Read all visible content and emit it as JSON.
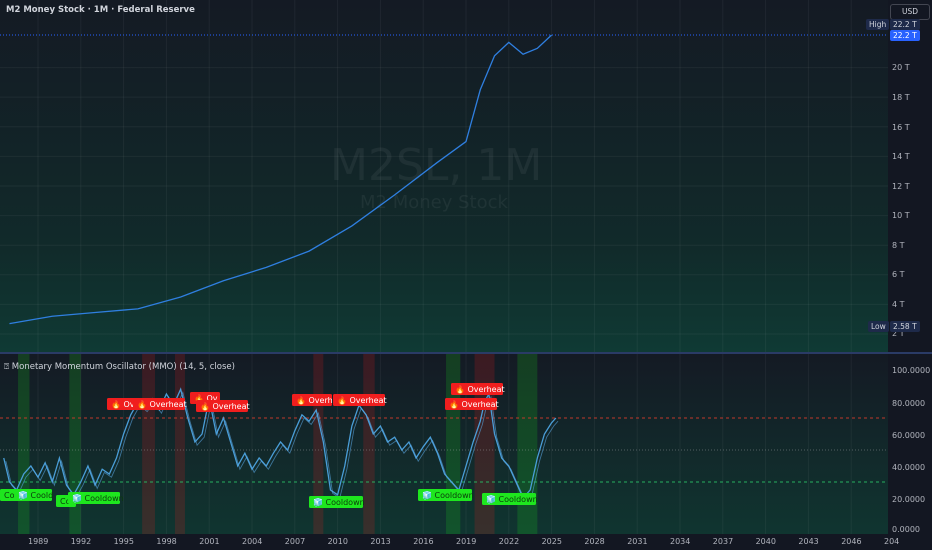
{
  "header": {
    "title": "M2 Money Stock · 1M · Federal Reserve",
    "currency": "USD"
  },
  "watermark": {
    "symbol": "M2SL, 1M",
    "name": "M2 Money Stock"
  },
  "main_axis": {
    "ticks": [
      "20 T",
      "18 T",
      "16 T",
      "14 T",
      "12 T",
      "10 T",
      "8 T",
      "6 T",
      "4 T",
      "2 T"
    ],
    "high_label": "High",
    "high_value": "22.2 T",
    "high_price": "22.2 T",
    "low_label": "Low",
    "low_value": "2.58 T"
  },
  "oscillator": {
    "title": "⍰ Monetary Momentum Oscillator (MMO) (14, 5, close)",
    "ticks": [
      "100.0000",
      "80.0000",
      "60.0000",
      "40.0000",
      "20.0000",
      "0.0000"
    ],
    "overbought": 70,
    "oversold": 30,
    "overheat_label": "🔥 Overheat",
    "overheat_partial": "🔥 Overh",
    "overheat_partial2": "🔥 Ov",
    "cooldown_label": "🧊 Cooldown",
    "cooldown_partial": "🧊 Coold",
    "cooldown_partial2": "Co"
  },
  "time_axis": [
    "1989",
    "1992",
    "1995",
    "1998",
    "2001",
    "2004",
    "2007",
    "2010",
    "2013",
    "2016",
    "2019",
    "2022",
    "2025",
    "2028",
    "2031",
    "2034",
    "2037",
    "2040",
    "2043",
    "2046",
    "204"
  ],
  "colors": {
    "line": "#2f7fe0",
    "overheat": "#f01e1e",
    "cooldown": "#1ee61e",
    "accent": "#2962ff"
  },
  "chart_data": {
    "type": "line",
    "title": "M2 Money Stock",
    "x": [
      "1987",
      "1990",
      "1993",
      "1996",
      "1999",
      "2002",
      "2005",
      "2008",
      "2011",
      "2014",
      "2017",
      "2019",
      "2020",
      "2021",
      "2022",
      "2023",
      "2024",
      "2025"
    ],
    "series": [
      {
        "values": [
          2.7,
          3.2,
          3.45,
          3.7,
          4.5,
          5.6,
          6.5,
          7.6,
          9.3,
          11.4,
          13.6,
          15.0,
          18.5,
          20.8,
          21.7,
          20.9,
          21.3,
          22.2
        ]
      }
    ],
    "ylim": [
      1.5,
      22.5
    ]
  }
}
